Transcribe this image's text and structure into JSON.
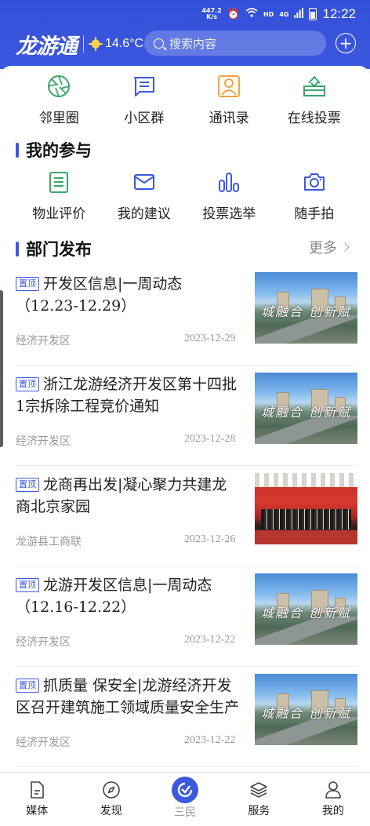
{
  "status_bar": {
    "net_speed_value": "447.2",
    "net_speed_unit": "K/s",
    "network": "HD",
    "signal": "4G",
    "time": "12:22"
  },
  "header": {
    "logo": "龙游通",
    "temperature": "14.6°C",
    "search_placeholder": "搜索内容",
    "plus_label": "+"
  },
  "quick_top": [
    {
      "label": "邻里圈",
      "icon": "aperture-icon",
      "color": "#3aa66a"
    },
    {
      "label": "小区群",
      "icon": "chat-icon",
      "color": "#3b58de"
    },
    {
      "label": "通讯录",
      "icon": "contact-icon",
      "color": "#f2a33a"
    },
    {
      "label": "在线投票",
      "icon": "vote-icon",
      "color": "#3aa66a"
    }
  ],
  "section_participation": {
    "title": "我的参与"
  },
  "quick_second": [
    {
      "label": "物业评价",
      "icon": "clipboard-icon",
      "color": "#3aa66a"
    },
    {
      "label": "我的建议",
      "icon": "mail-icon",
      "color": "#3b58de"
    },
    {
      "label": "投票选举",
      "icon": "bar-chart-icon",
      "color": "#3b58de"
    },
    {
      "label": "随手拍",
      "icon": "camera-icon",
      "color": "#3b58de"
    }
  ],
  "section_department": {
    "title": "部门发布",
    "more": "更多"
  },
  "pin_label": "置顶",
  "news": [
    {
      "title": "开发区信息|一周动态（12.23-12.29）",
      "source": "经济开发区",
      "date": "2023-12-29",
      "image": "city",
      "caption": "城融合 创新赋"
    },
    {
      "title": "浙江龙游经济开发区第十四批1宗拆除工程竞价通知",
      "source": "经济开发区",
      "date": "2023-12-28",
      "image": "city",
      "caption": "城融合 创新赋"
    },
    {
      "title": "龙商再出发|凝心聚力共建龙商北京家园",
      "source": "龙游县工商联",
      "date": "2023-12-26",
      "image": "event",
      "caption": ""
    },
    {
      "title": "龙游开发区信息|一周动态（12.16-12.22）",
      "source": "经济开发区",
      "date": "2023-12-22",
      "image": "city",
      "caption": "城融合 创新赋"
    },
    {
      "title": "抓质量 保安全|龙游经济开发区召开建筑施工领域质量安全生产",
      "source": "经济开发区",
      "date": "2023-12-22",
      "image": "city",
      "caption": "城融合 创新赋"
    }
  ],
  "tabs": [
    {
      "label": "媒体",
      "icon": "document-icon",
      "active": false
    },
    {
      "label": "发现",
      "icon": "compass-icon",
      "active": false
    },
    {
      "label": "三民",
      "icon": "sanmin-icon",
      "active": true
    },
    {
      "label": "服务",
      "icon": "layers-icon",
      "active": false
    },
    {
      "label": "我的",
      "icon": "person-icon",
      "active": false
    }
  ],
  "colors": {
    "brand": "#3b58de",
    "green": "#3aa66a",
    "orange": "#f2a33a"
  }
}
